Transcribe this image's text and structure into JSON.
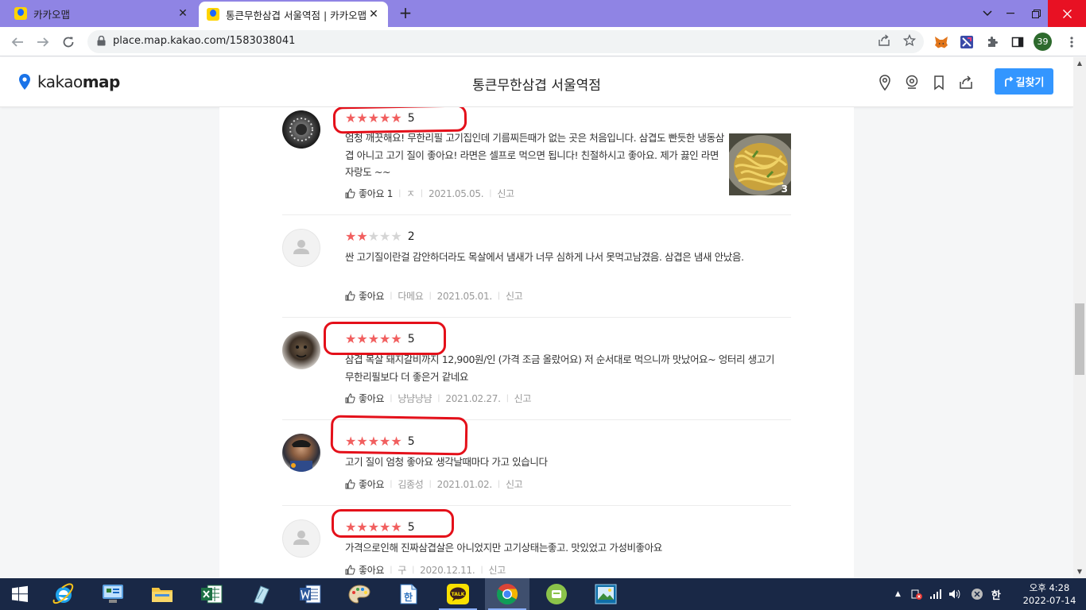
{
  "browser": {
    "tabs": [
      {
        "title": "카카오맵",
        "active": false
      },
      {
        "title": "통큰무한삼겹 서울역점 | 카카오맵",
        "active": true
      }
    ],
    "url": "place.map.kakao.com/1583038041",
    "profile_badge": "39"
  },
  "header": {
    "logo_light": "kakao",
    "logo_bold": "map",
    "place_title": "통큰무한삼겹 서울역점",
    "route_button": "길찾기"
  },
  "reviews": [
    {
      "rating": 5,
      "score_text": "5",
      "text": "엄청 깨끗해요!  무한리필 고기집인데 기름찌든때가 없는 곳은 처음입니다. 삼겹도 빤듯한 냉동삼겹 아니고 고기 질이 좋아요!   라면은 셀프로 먹으면 됩니다! 친절하시고 좋아요.  제가 끓인 라면 자랑도 ~~",
      "like_label": "좋아요",
      "like_count": "1",
      "author": "ㅈ",
      "date": "2021.05.05.",
      "report": "신고",
      "photo_count": "3"
    },
    {
      "rating": 2,
      "score_text": "2",
      "text": "싼 고기질이란걸 감안하더라도 목살에서 냄새가 너무 심하게 나서 못먹고남겼음. 삼겹은 냄새 안났음.",
      "like_label": "좋아요",
      "author": "다메요",
      "date": "2021.05.01.",
      "report": "신고"
    },
    {
      "rating": 5,
      "score_text": "5",
      "text": "삼겹 목살 돼지갈비까지 12,900원/인 (가격 조금 올랐어요) 저 순서대로 먹으니까 맛났어요~ 엉터리 생고기 무한리필보다 더 좋은거 같네요",
      "like_label": "좋아요",
      "author": "냥냠냥냠",
      "date": "2021.02.27.",
      "report": "신고"
    },
    {
      "rating": 5,
      "score_text": "5",
      "text": "고기 질이 엄청 좋아요 생각날때마다 가고 있습니다",
      "like_label": "좋아요",
      "author": "김종성",
      "date": "2021.01.02.",
      "report": "신고"
    },
    {
      "rating": 5,
      "score_text": "5",
      "text": "가격으로인해  진짜삼겹살은 아니었지만 고기상태는좋고. 맛있었고 가성비좋아요",
      "like_label": "좋아요",
      "author": "구",
      "date": "2020.12.11.",
      "report": "신고"
    }
  ],
  "taskbar": {
    "kakaotalk_label": "TALK",
    "ime_label": "한",
    "clock_time": "오후 4:28",
    "clock_date": "2022-07-14"
  },
  "colors": {
    "star_on": "#f15f5f",
    "star_off": "#d5d5d5",
    "route_button": "#3396ff",
    "annotation_red": "#e4101a",
    "tab_strip": "#8f84e4",
    "taskbar": "#192846"
  }
}
